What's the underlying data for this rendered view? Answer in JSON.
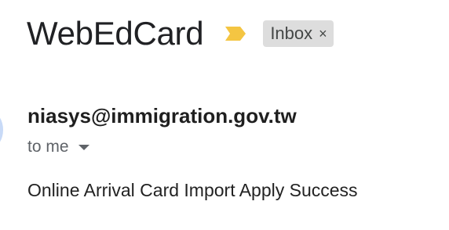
{
  "email": {
    "subject": "WebEdCard",
    "importance_icon": "importance-marker-icon",
    "importance_color": "#F4C542",
    "label": {
      "text": "Inbox",
      "close_glyph": "×"
    },
    "sender": "niasys@immigration.gov.tw",
    "recipient": "to me",
    "body": "Online Arrival Card Import Apply Success"
  },
  "colors": {
    "label_chip_bg": "#DDDDDD",
    "avatar": "#C8DAF7"
  }
}
